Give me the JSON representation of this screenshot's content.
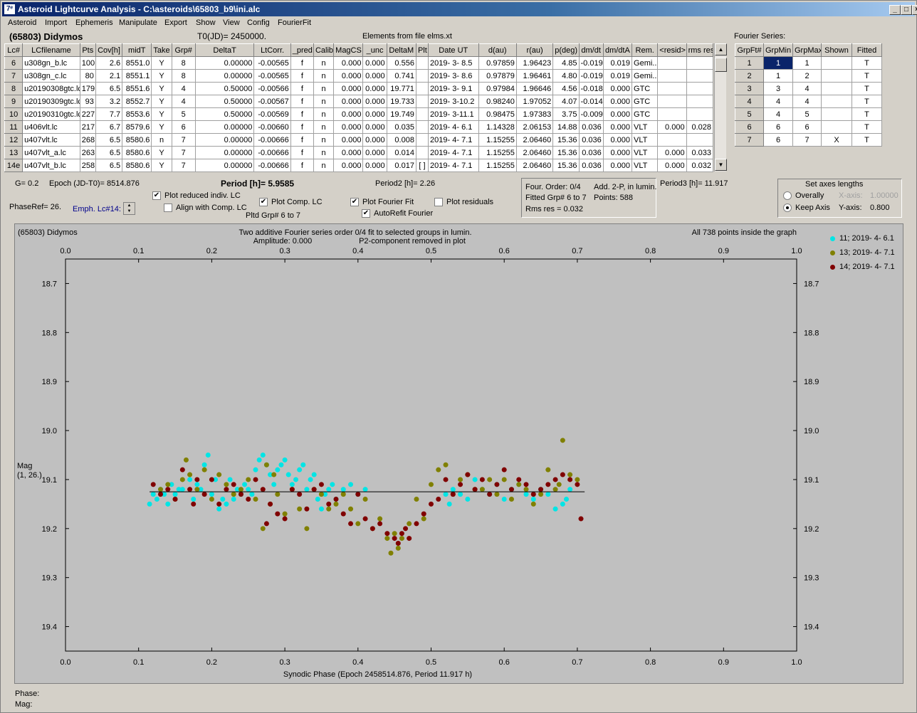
{
  "window": {
    "title": "Asteroid Lightcurve Analysis - C:\\asteroids\\65803_b9\\ini.alc",
    "buttons": {
      "minimize": "_",
      "maximize": "□",
      "close": "×"
    }
  },
  "menu": [
    "Asteroid",
    "Import",
    "Ephemeris",
    "Manipulate",
    "Export",
    "Show",
    "View",
    "Config",
    "FourierFit"
  ],
  "header": {
    "asteroid": "(65803) Didymos",
    "t0": "T0(JD)= 2450000.",
    "elements": "Elements from file elms.xt",
    "fourier_title": "Fourier Series:"
  },
  "lc_table": {
    "columns": [
      "Lc#",
      "LCfilename",
      "Pts",
      "Cov[h]",
      "midT",
      "Take",
      "Grp#",
      "DeltaT",
      "LtCorr.",
      "_pred.",
      "Calib",
      "MagCS",
      "_unc",
      "DeltaM",
      "Plt",
      "Date UT",
      "d(au)",
      "r(au)",
      "p(deg)",
      "dm/dt",
      "dm/dtA",
      "Rem.",
      "<resid>",
      "rms res"
    ],
    "rows": [
      [
        "6",
        "u308gn_b.lc",
        "100",
        "2.6",
        "8551.0",
        "Y",
        "8",
        "0.00000",
        "-0.00565",
        "f",
        "n",
        "0.000",
        "0.000",
        "0.556",
        "",
        "2019- 3- 8.5",
        "0.97859",
        "1.96423",
        "4.85",
        "-0.019",
        "0.019",
        "Gemi...",
        "",
        ""
      ],
      [
        "7",
        "u308gn_c.lc",
        "80",
        "2.1",
        "8551.1",
        "Y",
        "8",
        "0.00000",
        "-0.00565",
        "f",
        "n",
        "0.000",
        "0.000",
        "0.741",
        "",
        "2019- 3- 8.6",
        "0.97879",
        "1.96461",
        "4.80",
        "-0.019",
        "0.019",
        "Gemi...",
        "",
        ""
      ],
      [
        "8",
        "u20190308gtc.lc",
        "179",
        "6.5",
        "8551.6",
        "Y",
        "4",
        "0.50000",
        "-0.00566",
        "f",
        "n",
        "0.000",
        "0.000",
        "19.771",
        "",
        "2019- 3- 9.1",
        "0.97984",
        "1.96646",
        "4.56",
        "-0.018",
        "0.000",
        "GTC",
        "",
        ""
      ],
      [
        "9",
        "u20190309gtc.lc",
        "93",
        "3.2",
        "8552.7",
        "Y",
        "4",
        "0.50000",
        "-0.00567",
        "f",
        "n",
        "0.000",
        "0.000",
        "19.733",
        "",
        "2019- 3-10.2",
        "0.98240",
        "1.97052",
        "4.07",
        "-0.014",
        "0.000",
        "GTC",
        "",
        ""
      ],
      [
        "10",
        "u20190310gtc.lc",
        "227",
        "7.7",
        "8553.6",
        "Y",
        "5",
        "0.50000",
        "-0.00569",
        "f",
        "n",
        "0.000",
        "0.000",
        "19.749",
        "",
        "2019- 3-11.1",
        "0.98475",
        "1.97383",
        "3.75",
        "-0.009",
        "0.000",
        "GTC",
        "",
        ""
      ],
      [
        "11",
        "u406vlt.lc",
        "217",
        "6.7",
        "8579.6",
        "Y",
        "6",
        "0.00000",
        "-0.00660",
        "f",
        "n",
        "0.000",
        "0.000",
        "0.035",
        "",
        "2019- 4- 6.1",
        "1.14328",
        "2.06153",
        "14.88",
        "0.036",
        "0.000",
        "VLT",
        "0.000",
        "0.028"
      ],
      [
        "12",
        "u407vlt.lc",
        "268",
        "6.5",
        "8580.6",
        "n",
        "7",
        "0.00000",
        "-0.00666",
        "f",
        "n",
        "0.000",
        "0.000",
        "0.008",
        "",
        "2019- 4- 7.1",
        "1.15255",
        "2.06460",
        "15.36",
        "0.036",
        "0.000",
        "VLT",
        "",
        ""
      ],
      [
        "13",
        "u407vlt_a.lc",
        "263",
        "6.5",
        "8580.6",
        "Y",
        "7",
        "0.00000",
        "-0.00666",
        "f",
        "n",
        "0.000",
        "0.000",
        "0.014",
        "",
        "2019- 4- 7.1",
        "1.15255",
        "2.06460",
        "15.36",
        "0.036",
        "0.000",
        "VLT",
        "0.000",
        "0.033"
      ],
      [
        "14e",
        "u407vlt_b.lc",
        "258",
        "6.5",
        "8580.6",
        "Y",
        "7",
        "0.00000",
        "-0.00666",
        "f",
        "n",
        "0.000",
        "0.000",
        "0.017",
        "[ ]",
        "2019- 4- 7.1",
        "1.15255",
        "2.06460",
        "15.36",
        "0.036",
        "0.000",
        "VLT",
        "0.000",
        "0.032"
      ]
    ]
  },
  "fourier_table": {
    "columns": [
      "GrpFt#",
      "GrpMin",
      "GrpMax",
      "Shown",
      "Fitted"
    ],
    "rows": [
      [
        "1",
        "1",
        "1",
        "",
        "T"
      ],
      [
        "2",
        "1",
        "2",
        "",
        "T"
      ],
      [
        "3",
        "3",
        "4",
        "",
        "T"
      ],
      [
        "4",
        "4",
        "4",
        "",
        "T"
      ],
      [
        "5",
        "4",
        "5",
        "",
        "T"
      ],
      [
        "6",
        "6",
        "6",
        "",
        "T"
      ],
      [
        "7",
        "6",
        "7",
        "X",
        "T"
      ]
    ]
  },
  "controls": {
    "g": "G= 0.2",
    "epoch": "Epoch (JD-T0)= 8514.876",
    "period": "Period [h]= 5.9585",
    "period2": "Period2 [h]= 2.26",
    "period3": "Period3 [h]= 11.917",
    "phase_ref": "PhaseRef= 26.",
    "emph": "Emph. Lc#14:",
    "plot_reduced": "Plot reduced indiv. LC",
    "align_comp": "Align with Comp. LC",
    "plot_comp": "Plot Comp. LC",
    "plot_fourier": "Plot Fourier Fit",
    "plot_residuals": "Plot residuals",
    "autorefit": "AutoRefit Fourier",
    "pltd_grp": "Pltd Grp#  6  to  7"
  },
  "fit_info": {
    "four_order": "Four. Order:  0/4",
    "add": "Add. 2-P, in lumin.",
    "fitted": "Fitted Grp# 6 to 7",
    "points": "Points: 588",
    "rms": "Rms res      = 0.032"
  },
  "axes_box": {
    "title": "Set axes lengths",
    "overall": "Overally",
    "keep": "Keep Axis",
    "x_label": "X-axis:",
    "x_value": "1.00000",
    "y_label": "Y-axis:",
    "y_value": "0.800"
  },
  "status": {
    "phase": "Phase:",
    "mag": "Mag:"
  },
  "colors": {
    "cyan": "#00e5e5",
    "olive": "#808000",
    "maroon": "#800000"
  },
  "chart_data": {
    "type": "scatter",
    "title": "(65803) Didymos",
    "subtitle1": "Two additive Fourier series order 0/4 fit to selected groups in lumin.",
    "subtitle2": "Amplitude: 0.000",
    "subtitle3": "P2-component removed in plot",
    "note": "All 738 points inside the graph",
    "xlabel": "Synodic Phase (Epoch 2458514.876, Period 11.917 h)",
    "ylabel": "Mag\n(1, 26.)",
    "xlim": [
      0.0,
      1.0
    ],
    "ylim": [
      18.65,
      19.45
    ],
    "xticks": [
      "0.0",
      "0.1",
      "0.2",
      "0.3",
      "0.4",
      "0.5",
      "0.6",
      "0.7",
      "0.8",
      "0.9",
      "1.0"
    ],
    "yticks": [
      "18.7",
      "18.8",
      "18.9",
      "19.0",
      "19.1",
      "19.2",
      "19.3",
      "19.4"
    ],
    "fit_line": {
      "x": [
        0.115,
        0.71
      ],
      "y": 19.125
    },
    "series": [
      {
        "name": "11; 2019- 4- 6.1",
        "color": "#00e5e5",
        "x": [
          0.115,
          0.12,
          0.125,
          0.13,
          0.135,
          0.14,
          0.145,
          0.15,
          0.155,
          0.16,
          0.17,
          0.175,
          0.18,
          0.185,
          0.19,
          0.195,
          0.2,
          0.205,
          0.21,
          0.215,
          0.22,
          0.225,
          0.23,
          0.235,
          0.24,
          0.245,
          0.25,
          0.255,
          0.26,
          0.265,
          0.27,
          0.275,
          0.28,
          0.285,
          0.29,
          0.295,
          0.3,
          0.305,
          0.31,
          0.315,
          0.32,
          0.325,
          0.33,
          0.335,
          0.34,
          0.345,
          0.35,
          0.355,
          0.36,
          0.365,
          0.37,
          0.38,
          0.39,
          0.4,
          0.41,
          0.52,
          0.525,
          0.53,
          0.54,
          0.55,
          0.56,
          0.57,
          0.58,
          0.59,
          0.6,
          0.61,
          0.62,
          0.63,
          0.64,
          0.65,
          0.66,
          0.67,
          0.68,
          0.685,
          0.69
        ],
        "y": [
          19.15,
          19.13,
          19.14,
          19.12,
          19.13,
          19.15,
          19.11,
          19.13,
          19.12,
          19.12,
          19.1,
          19.14,
          19.11,
          19.12,
          19.07,
          19.05,
          19.13,
          19.1,
          19.16,
          19.14,
          19.15,
          19.1,
          19.14,
          19.12,
          19.13,
          19.11,
          19.12,
          19.13,
          19.08,
          19.06,
          19.05,
          19.07,
          19.09,
          19.11,
          19.08,
          19.07,
          19.06,
          19.09,
          19.11,
          19.1,
          19.08,
          19.07,
          19.12,
          19.1,
          19.09,
          19.14,
          19.16,
          19.13,
          19.12,
          19.11,
          19.14,
          19.12,
          19.11,
          19.13,
          19.12,
          19.13,
          19.15,
          19.12,
          19.13,
          19.14,
          19.1,
          19.12,
          19.13,
          19.11,
          19.14,
          19.12,
          19.11,
          19.13,
          19.14,
          19.12,
          19.13,
          19.16,
          19.15,
          19.14,
          19.12
        ]
      },
      {
        "name": "13; 2019- 4- 7.1",
        "color": "#808000",
        "x": [
          0.13,
          0.14,
          0.15,
          0.16,
          0.165,
          0.17,
          0.18,
          0.19,
          0.2,
          0.21,
          0.22,
          0.23,
          0.24,
          0.25,
          0.26,
          0.27,
          0.275,
          0.28,
          0.285,
          0.29,
          0.3,
          0.31,
          0.32,
          0.33,
          0.34,
          0.35,
          0.36,
          0.37,
          0.38,
          0.39,
          0.4,
          0.41,
          0.42,
          0.43,
          0.44,
          0.445,
          0.45,
          0.455,
          0.46,
          0.47,
          0.48,
          0.49,
          0.5,
          0.51,
          0.52,
          0.53,
          0.54,
          0.55,
          0.56,
          0.57,
          0.58,
          0.59,
          0.6,
          0.61,
          0.62,
          0.63,
          0.64,
          0.65,
          0.66,
          0.67,
          0.675,
          0.68,
          0.69,
          0.7
        ],
        "y": [
          19.12,
          19.11,
          19.14,
          19.1,
          19.06,
          19.09,
          19.12,
          19.08,
          19.14,
          19.09,
          19.11,
          19.13,
          19.12,
          19.1,
          19.14,
          19.2,
          19.07,
          19.15,
          19.09,
          19.13,
          19.17,
          19.12,
          19.16,
          19.2,
          19.12,
          19.13,
          19.16,
          19.15,
          19.13,
          19.16,
          19.19,
          19.14,
          19.2,
          19.18,
          19.22,
          19.25,
          19.21,
          19.24,
          19.22,
          19.19,
          19.14,
          19.18,
          19.11,
          19.08,
          19.07,
          19.13,
          19.1,
          19.09,
          19.12,
          19.12,
          19.1,
          19.13,
          19.1,
          19.14,
          19.11,
          19.12,
          19.15,
          19.13,
          19.08,
          19.12,
          19.11,
          19.02,
          19.09,
          19.1
        ]
      },
      {
        "name": "14; 2019- 4- 7.1",
        "color": "#800000",
        "x": [
          0.12,
          0.13,
          0.14,
          0.15,
          0.16,
          0.17,
          0.175,
          0.18,
          0.19,
          0.2,
          0.21,
          0.22,
          0.23,
          0.24,
          0.25,
          0.26,
          0.27,
          0.275,
          0.28,
          0.29,
          0.3,
          0.31,
          0.32,
          0.33,
          0.34,
          0.35,
          0.36,
          0.37,
          0.38,
          0.39,
          0.4,
          0.41,
          0.42,
          0.43,
          0.44,
          0.45,
          0.455,
          0.46,
          0.465,
          0.47,
          0.48,
          0.49,
          0.5,
          0.51,
          0.52,
          0.53,
          0.54,
          0.55,
          0.56,
          0.57,
          0.58,
          0.59,
          0.6,
          0.61,
          0.62,
          0.63,
          0.64,
          0.65,
          0.66,
          0.67,
          0.68,
          0.69,
          0.7,
          0.705
        ],
        "y": [
          19.11,
          19.13,
          19.12,
          19.14,
          19.08,
          19.12,
          19.15,
          19.1,
          19.13,
          19.1,
          19.15,
          19.12,
          19.11,
          19.13,
          19.14,
          19.1,
          19.12,
          19.19,
          19.15,
          19.17,
          19.18,
          19.12,
          19.13,
          19.16,
          19.12,
          19.11,
          19.15,
          19.14,
          19.17,
          19.19,
          19.13,
          19.18,
          19.2,
          19.19,
          19.21,
          19.22,
          19.23,
          19.21,
          19.2,
          19.22,
          19.19,
          19.17,
          19.15,
          19.14,
          19.1,
          19.13,
          19.11,
          19.09,
          19.12,
          19.1,
          19.13,
          19.11,
          19.08,
          19.12,
          19.1,
          19.11,
          19.13,
          19.12,
          19.11,
          19.1,
          19.09,
          19.1,
          19.11,
          19.18
        ]
      }
    ]
  }
}
